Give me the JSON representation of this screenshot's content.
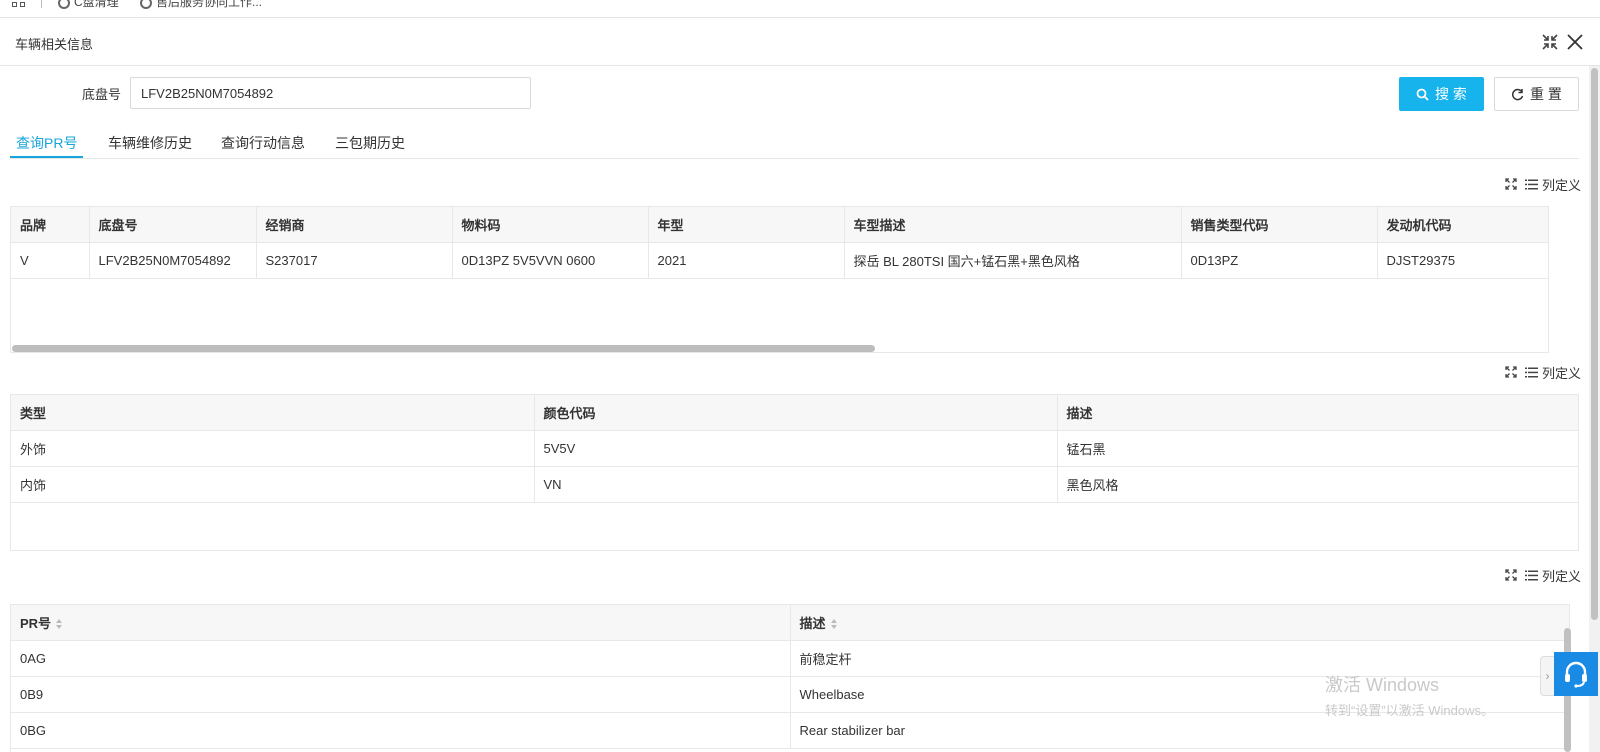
{
  "bookmarks": [
    {
      "label": "C盘清理"
    },
    {
      "label": "售后服务协同工作..."
    }
  ],
  "dialog": {
    "title": "车辆相关信息"
  },
  "search": {
    "label": "底盘号",
    "value": "LFV2B25N0M7054892",
    "search_button": "搜 索",
    "reset_button": "重 置"
  },
  "tabs": [
    {
      "label": "查询PR号",
      "active": true
    },
    {
      "label": "车辆维修历史",
      "active": false
    },
    {
      "label": "查询行动信息",
      "active": false
    },
    {
      "label": "三包期历史",
      "active": false
    }
  ],
  "toolbar": {
    "column_def_label": "列定义"
  },
  "vehicle_table": {
    "headers": [
      "品牌",
      "底盘号",
      "经销商",
      "物料码",
      "年型",
      "车型描述",
      "销售类型代码",
      "发动机代码"
    ],
    "rows": [
      [
        "V",
        "LFV2B25N0M7054892",
        "S237017",
        "0D13PZ 5V5VVN 0600",
        "2021",
        "探岳 BL 280TSI 国六+锰石黑+黑色风格",
        "0D13PZ",
        "DJST29375"
      ]
    ]
  },
  "color_table": {
    "headers": [
      "类型",
      "颜色代码",
      "描述"
    ],
    "rows": [
      [
        "外饰",
        "5V5V",
        "锰石黑"
      ],
      [
        "内饰",
        "VN",
        "黑色风格"
      ]
    ]
  },
  "pr_table": {
    "headers": [
      "PR号",
      "描述"
    ],
    "rows": [
      [
        "0AG",
        "前稳定杆"
      ],
      [
        "0B9",
        "Wheelbase"
      ],
      [
        "0BG",
        "Rear stabilizer bar"
      ]
    ]
  },
  "watermark": {
    "line1": "激活 Windows",
    "line2": "转到“设置”以激活 Windows。"
  },
  "colors": {
    "primary": "#17b3ec",
    "tab_active": "#17a5dc",
    "support": "#1a8be4"
  }
}
